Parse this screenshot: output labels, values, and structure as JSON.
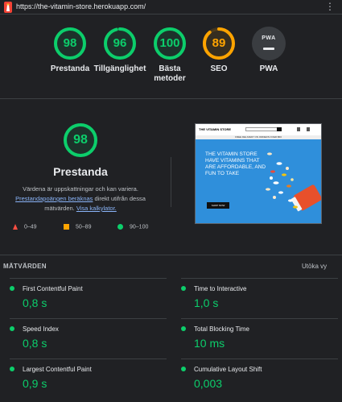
{
  "browser": {
    "url": "https://the-vitamin-store.herokuapp.com/",
    "menu_icon": "kebab-menu-icon",
    "site_icon": "lighthouse-icon"
  },
  "gauges": [
    {
      "score": "98",
      "label": "Prestanda",
      "color": "#0cce6b",
      "fraction": 0.98
    },
    {
      "score": "96",
      "label": "Tillgänglighet",
      "color": "#0cce6b",
      "fraction": 0.96
    },
    {
      "score": "100",
      "label": "Bästa metoder",
      "color": "#0cce6b",
      "fraction": 1.0
    },
    {
      "score": "89",
      "label": "SEO",
      "color": "#ffa400",
      "fraction": 0.89
    },
    {
      "score": "PWA",
      "label": "PWA",
      "color": "#3a3d41",
      "fraction": 0
    }
  ],
  "performance": {
    "score": "98",
    "title": "Prestanda",
    "desc_1": "Värdena är uppskattningar och kan variera.",
    "link_1": "Prestandapoängen beräknas",
    "desc_2": " direkt utifrån dessa mätvärden. ",
    "link_2": "Visa kalkylator."
  },
  "legend": [
    {
      "range": "0–49",
      "shape": "triangle",
      "color": "#ff4e42"
    },
    {
      "range": "50–89",
      "shape": "square",
      "color": "#ffa400"
    },
    {
      "range": "90–100",
      "shape": "circle",
      "color": "#0cce6b"
    }
  ],
  "screenshot": {
    "brand": "THE VITAMIN STORE",
    "banner": "FREE DELIVERY ON ORDERS OVER $50",
    "headline": "The vitamin store have vitamins that are affordable, and fun to take",
    "button": "SHOP NOW"
  },
  "metrics_section": {
    "title": "MÄTVÄRDEN",
    "expand_label": "Utöka vy",
    "items": [
      {
        "name": "First Contentful Paint",
        "value": "0,8 s"
      },
      {
        "name": "Time to Interactive",
        "value": "1,0 s"
      },
      {
        "name": "Speed Index",
        "value": "0,8 s"
      },
      {
        "name": "Total Blocking Time",
        "value": "10 ms"
      },
      {
        "name": "Largest Contentful Paint",
        "value": "0,9 s"
      },
      {
        "name": "Cumulative Layout Shift",
        "value": "0,003"
      }
    ]
  },
  "colors": {
    "pass": "#0cce6b",
    "average": "#ffa400",
    "fail": "#ff4e42",
    "background": "#202124",
    "link": "#8ab4f8"
  }
}
